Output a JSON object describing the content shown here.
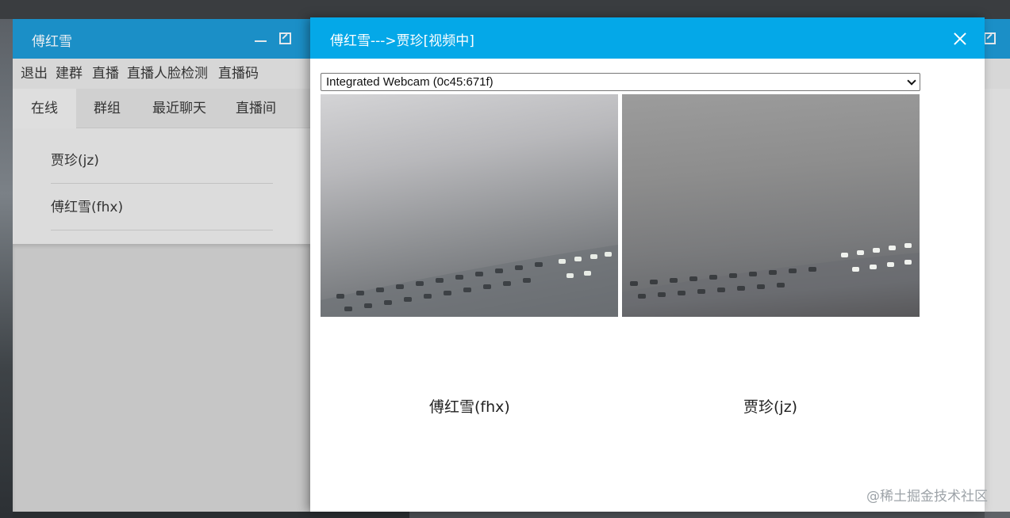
{
  "chat_window": {
    "title": "傅红雪",
    "menu": [
      "退出",
      "建群",
      "直播",
      "直播人脸检测",
      "直播码"
    ],
    "tabs": [
      "在线",
      "群组",
      "最近聊天",
      "直播间"
    ],
    "active_tab": "在线",
    "contacts": [
      "贾珍(jz)",
      "傅红雪(fhx)"
    ]
  },
  "dialog": {
    "title": "傅红雪--->贾珍[视频中]",
    "camera_select": "Integrated Webcam (0c45:671f)",
    "local_name": "傅红雪(fhx)",
    "remote_name": "贾珍(jz)"
  },
  "watermark": "@稀土掘金技术社区",
  "colors": {
    "dialog_header": "#04a8e8",
    "chat_titlebar": "#1b8fc7"
  }
}
